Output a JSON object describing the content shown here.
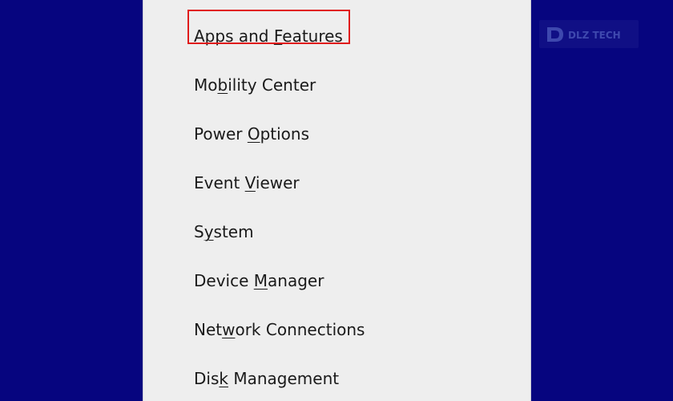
{
  "colors": {
    "desktop_bg": "#06057f",
    "menu_bg": "#eeeeee",
    "highlight": "#e01b1b",
    "text": "#1a1a1a"
  },
  "menu": {
    "items": [
      {
        "key": "apps",
        "before": "",
        "access": "A",
        "after": "pps and Features",
        "alt_before": "Apps and ",
        "alt_access": "F",
        "alt_after": "eatures",
        "highlighted": true
      },
      {
        "key": "mobility",
        "before": "Mo",
        "access": "b",
        "after": "ility Center",
        "highlighted": false
      },
      {
        "key": "power",
        "before": "Power ",
        "access": "O",
        "after": "ptions",
        "highlighted": false
      },
      {
        "key": "event",
        "before": "Event ",
        "access": "V",
        "after": "iewer",
        "highlighted": false
      },
      {
        "key": "system",
        "before": "S",
        "access": "y",
        "after": "stem",
        "highlighted": false
      },
      {
        "key": "device",
        "before": "Device ",
        "access": "M",
        "after": "anager",
        "highlighted": false
      },
      {
        "key": "network",
        "before": "Net",
        "access": "w",
        "after": "ork Connections",
        "highlighted": false
      },
      {
        "key": "disk",
        "before": "Dis",
        "access": "k",
        "after": " Management",
        "highlighted": false
      }
    ]
  },
  "watermark": {
    "text": "DLZ TECH"
  }
}
